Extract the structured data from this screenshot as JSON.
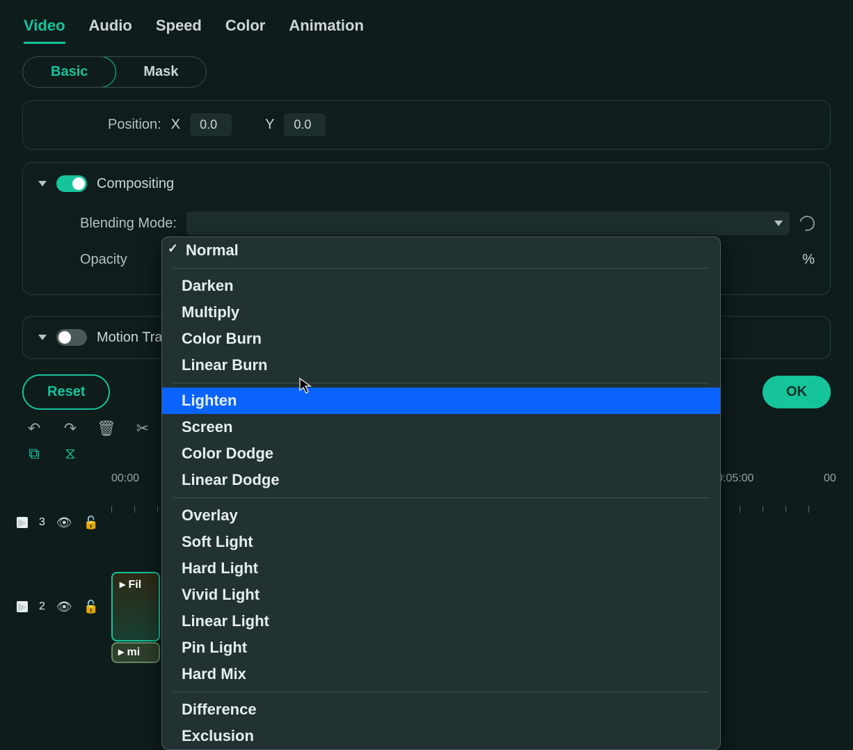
{
  "tabs": [
    "Video",
    "Audio",
    "Speed",
    "Color",
    "Animation"
  ],
  "active_tab": 0,
  "subtabs": [
    "Basic",
    "Mask"
  ],
  "active_subtab": 0,
  "position": {
    "label": "Position:",
    "x_label": "X",
    "x_value": "0.0",
    "y_label": "Y",
    "y_value": "0.0"
  },
  "compositing": {
    "title": "Compositing",
    "enabled": true,
    "blend_label": "Blending Mode:",
    "opacity_label": "Opacity",
    "opacity_unit": "%"
  },
  "motion": {
    "title": "Motion Track",
    "enabled": false
  },
  "buttons": {
    "reset": "Reset",
    "ok": "OK"
  },
  "timeline": {
    "ticks": [
      "00:00",
      "0:05:00",
      "00"
    ],
    "tracks": [
      {
        "num": "3"
      },
      {
        "num": "2",
        "clip_label": "Fil",
        "clip_label2": "mi"
      }
    ]
  },
  "dropdown": {
    "selected": "Normal",
    "highlighted": "Lighten",
    "groups": [
      [
        "Normal"
      ],
      [
        "Darken",
        "Multiply",
        "Color Burn",
        "Linear Burn"
      ],
      [
        "Lighten",
        "Screen",
        "Color Dodge",
        "Linear Dodge"
      ],
      [
        "Overlay",
        "Soft Light",
        "Hard Light",
        "Vivid Light",
        "Linear Light",
        "Pin Light",
        "Hard Mix"
      ],
      [
        "Difference",
        "Exclusion"
      ]
    ]
  }
}
